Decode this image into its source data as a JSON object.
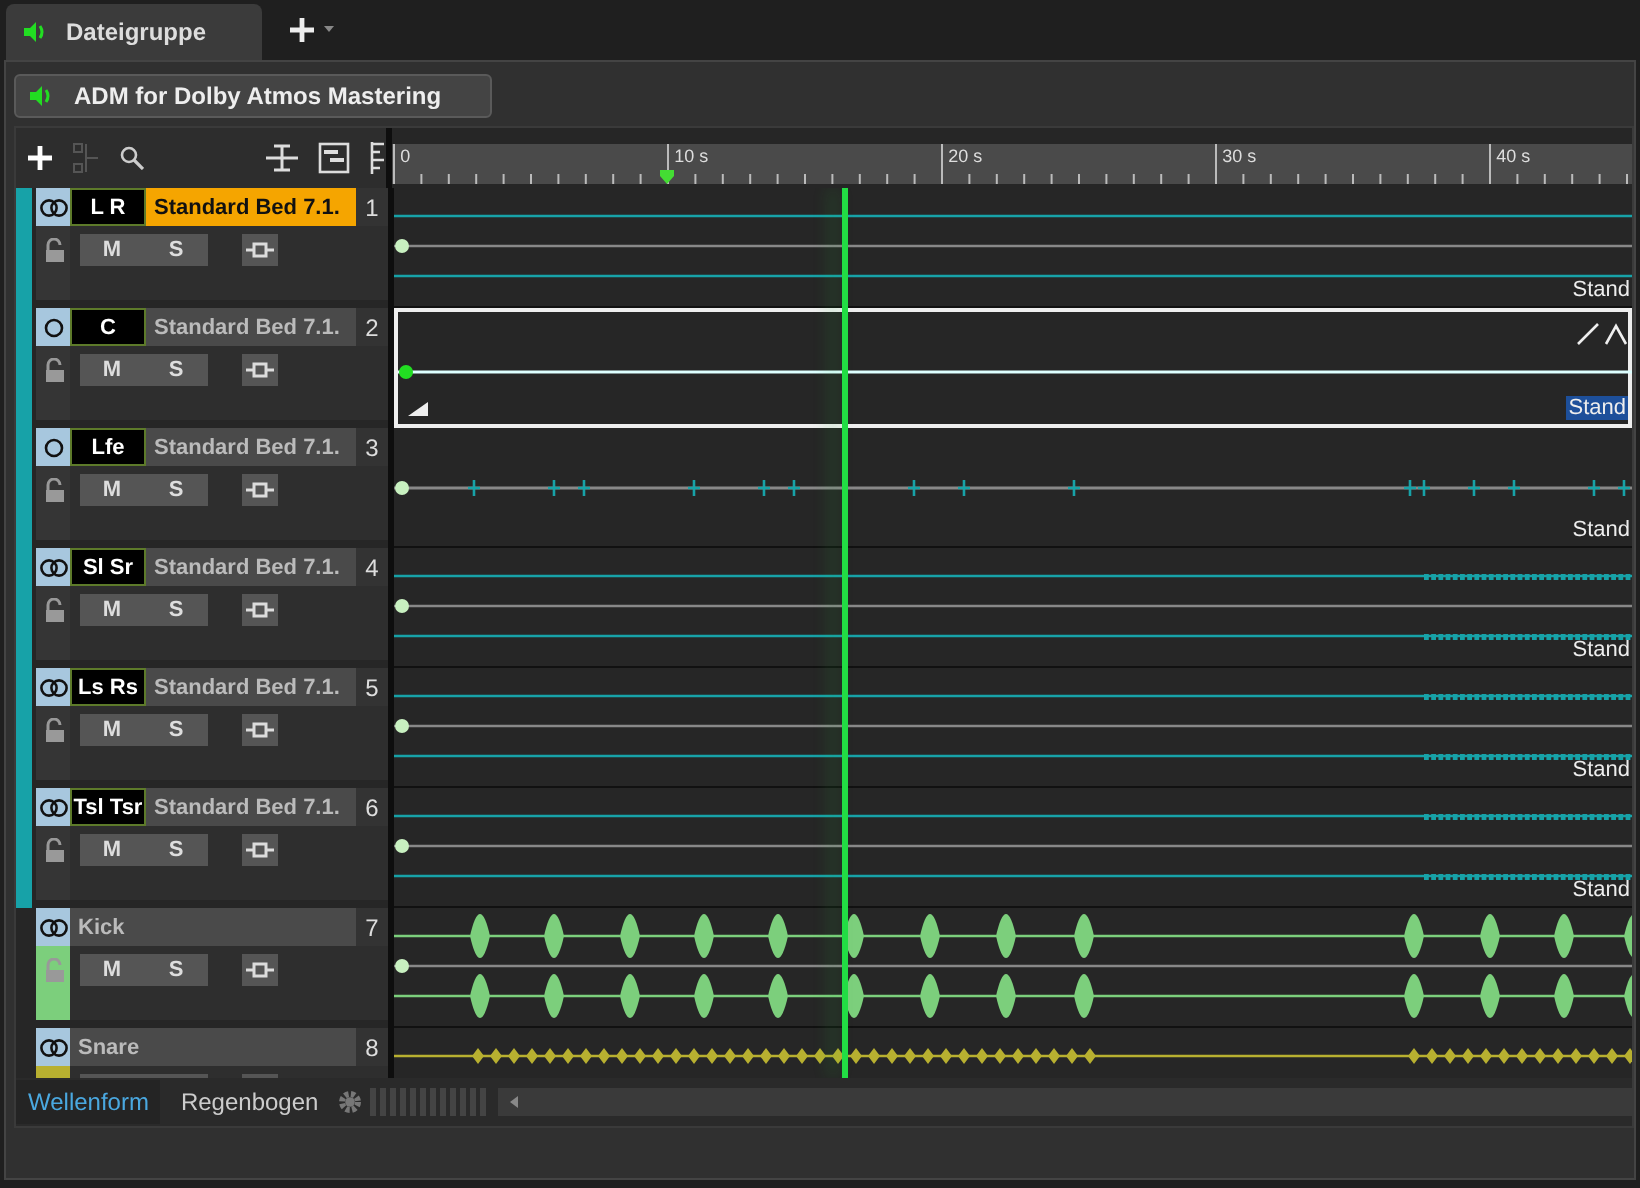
{
  "tabs": [
    {
      "label": "Dateigruppe",
      "selected": true
    }
  ],
  "group_button": {
    "label": "ADM for Dolby Atmos Mastering"
  },
  "ruler": {
    "labels": [
      "0",
      "10 s",
      "20 s",
      "30 s",
      "40 s"
    ]
  },
  "tracks": [
    {
      "kind": "bed",
      "stereo": true,
      "channel_label": "L R",
      "name": "Standard Bed 7.1.",
      "number": "1",
      "selected": true,
      "color": "#17a2a8",
      "mute_label": "M",
      "solo_label": "S",
      "clip_label": "Stand",
      "clip_selected": false
    },
    {
      "kind": "bed",
      "stereo": false,
      "channel_label": "C",
      "name": "Standard Bed 7.1.",
      "number": "2",
      "selected": false,
      "color": "#17a2a8",
      "mute_label": "M",
      "solo_label": "S",
      "clip_label": "Stand",
      "clip_selected": true
    },
    {
      "kind": "bed",
      "stereo": false,
      "channel_label": "Lfe",
      "name": "Standard Bed 7.1.",
      "number": "3",
      "selected": false,
      "color": "#17a2a8",
      "mute_label": "M",
      "solo_label": "S",
      "clip_label": "Stand",
      "clip_selected": false
    },
    {
      "kind": "bed",
      "stereo": true,
      "channel_label": "Sl Sr",
      "name": "Standard Bed 7.1.",
      "number": "4",
      "selected": false,
      "color": "#17a2a8",
      "mute_label": "M",
      "solo_label": "S",
      "clip_label": "Stand",
      "clip_selected": false
    },
    {
      "kind": "bed",
      "stereo": true,
      "channel_label": "Ls Rs",
      "name": "Standard Bed 7.1.",
      "number": "5",
      "selected": false,
      "color": "#17a2a8",
      "mute_label": "M",
      "solo_label": "S",
      "clip_label": "Stand",
      "clip_selected": false
    },
    {
      "kind": "bed",
      "stereo": true,
      "channel_label": "Tsl Tsr",
      "name": "Standard Bed 7.1.",
      "number": "6",
      "selected": false,
      "color": "#17a2a8",
      "mute_label": "M",
      "solo_label": "S",
      "clip_label": "Stand",
      "clip_selected": false
    },
    {
      "kind": "clip",
      "stereo": true,
      "name": "Kick",
      "number": "7",
      "selected": false,
      "color": "#7ccf7c",
      "mute_label": "M",
      "solo_label": "S"
    },
    {
      "kind": "pulse",
      "stereo": true,
      "name": "Snare",
      "number": "8",
      "selected": false,
      "color": "#b8b030"
    }
  ],
  "bottom_tabs": [
    {
      "label": "Wellenform",
      "selected": true
    },
    {
      "label": "Regenbogen",
      "selected": false
    }
  ]
}
